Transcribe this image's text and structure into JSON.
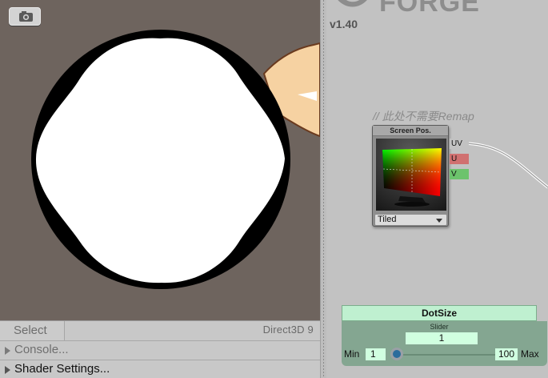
{
  "preview": {
    "camera_icon": "camera-icon",
    "select_label": "Select",
    "graphics_api": "Direct3D 9",
    "foldouts": [
      {
        "label": "Console..."
      },
      {
        "label": "Shader Settings..."
      }
    ]
  },
  "canvas": {
    "logo_text": "FORGE",
    "version": "v1.40",
    "comment": "// 此处不需要Remap",
    "screen_pos_node": {
      "title": "Screen Pos.",
      "mode": "Tiled",
      "ports": [
        {
          "label": "UV",
          "color": "#c2c2c2"
        },
        {
          "label": "U",
          "color": "#d07070"
        },
        {
          "label": "V",
          "color": "#6cc36c"
        }
      ]
    },
    "dotsize_node": {
      "title": "DotSize",
      "type": "Slider",
      "value": "1",
      "min_label": "Min",
      "min_value": "1",
      "max_value": "100",
      "max_label": "Max",
      "slider_fraction": 0
    }
  },
  "colors": {
    "preview_bg": "#6e645e",
    "panel_bg": "#c2c2c2",
    "slider_node_header": "#bff0d0",
    "slider_node_body": "#84a691"
  }
}
